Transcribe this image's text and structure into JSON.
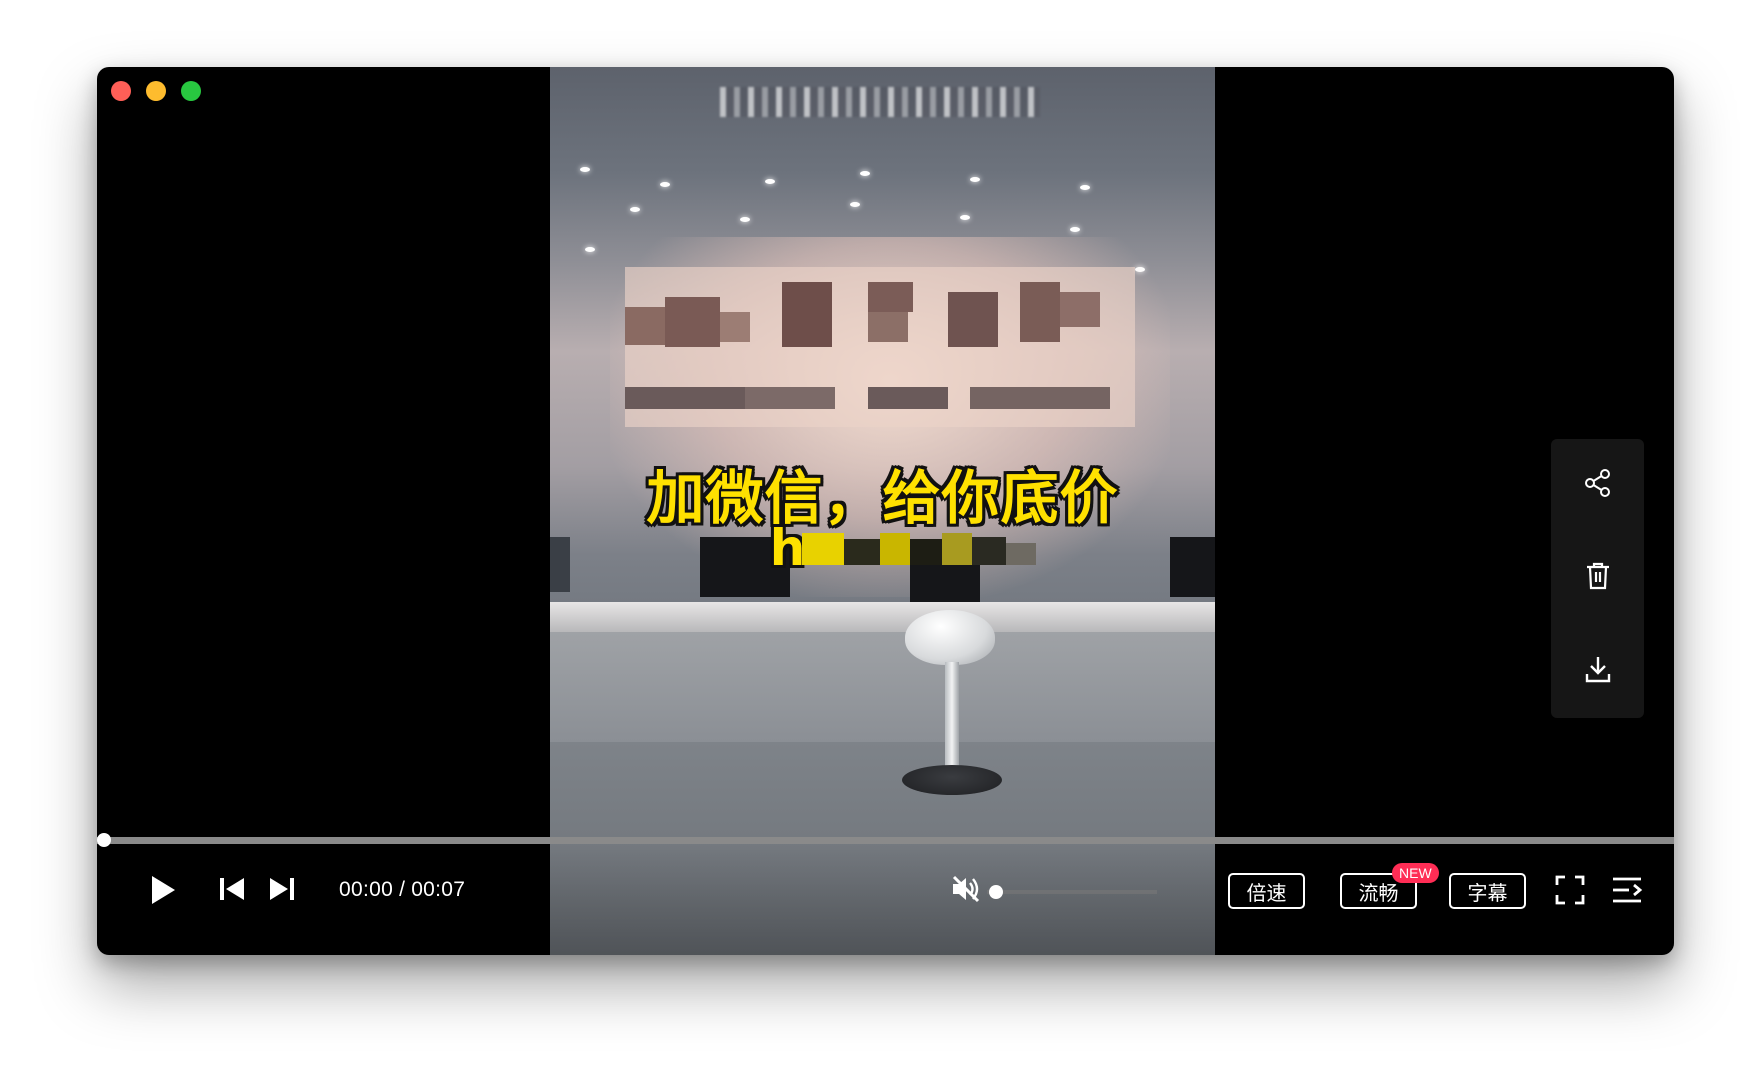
{
  "window": {
    "controls": [
      "close",
      "minimize",
      "zoom"
    ],
    "colors": {
      "close": "#ff5f57",
      "minimize": "#febc2e",
      "zoom": "#28c840"
    }
  },
  "video": {
    "subtitle_line1": "加微信，给你底价",
    "subtitle_line2_prefix": "h",
    "subtitle_color": "#ffe100"
  },
  "side_actions": [
    {
      "name": "share",
      "icon": "share-icon"
    },
    {
      "name": "delete",
      "icon": "trash-icon"
    },
    {
      "name": "download",
      "icon": "download-icon"
    }
  ],
  "player": {
    "progress_fraction": 0.0,
    "current_time": "00:00",
    "separator": "/",
    "duration": "00:07",
    "muted": true,
    "volume_fraction": 0.0,
    "speed_label": "倍速",
    "quality_label": "流畅",
    "quality_badge": "NEW",
    "subtitle_label": "字幕",
    "icons": [
      "play-icon",
      "previous-icon",
      "next-icon",
      "mute-icon",
      "fullscreen-icon",
      "playlist-icon"
    ]
  }
}
